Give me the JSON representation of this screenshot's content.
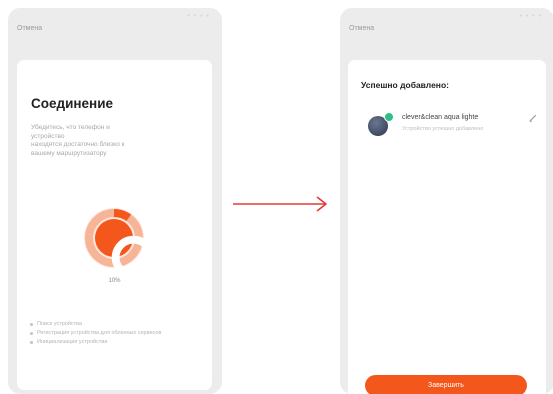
{
  "left_screen": {
    "cancel_label": "Отмена",
    "title": "Соединение",
    "description": [
      "Убедитесь, что телефон и",
      "устройство",
      "находятся достаточно близко к",
      "вашему маршрутизатору"
    ],
    "progress_percent": 10,
    "progress_label": "10%",
    "steps": [
      "Поиск устройства",
      "Регистрация устройства для облачных сервисов",
      "Инициализация устройства"
    ]
  },
  "right_screen": {
    "cancel_label": "Отмена",
    "success_title": "Успешно добавлено:",
    "device": {
      "name": "clever&clean aqua lighte",
      "status": "Устройство успешно добавлено"
    },
    "finish_label": "Завершить"
  },
  "colors": {
    "accent": "#f3571c",
    "ring_light": "#f7b598",
    "success_badge": "#2dbf86",
    "arrow": "#e53935"
  },
  "icons": {
    "search": "search-icon",
    "edit": "edit-icon",
    "arrow": "arrow-right-icon"
  }
}
